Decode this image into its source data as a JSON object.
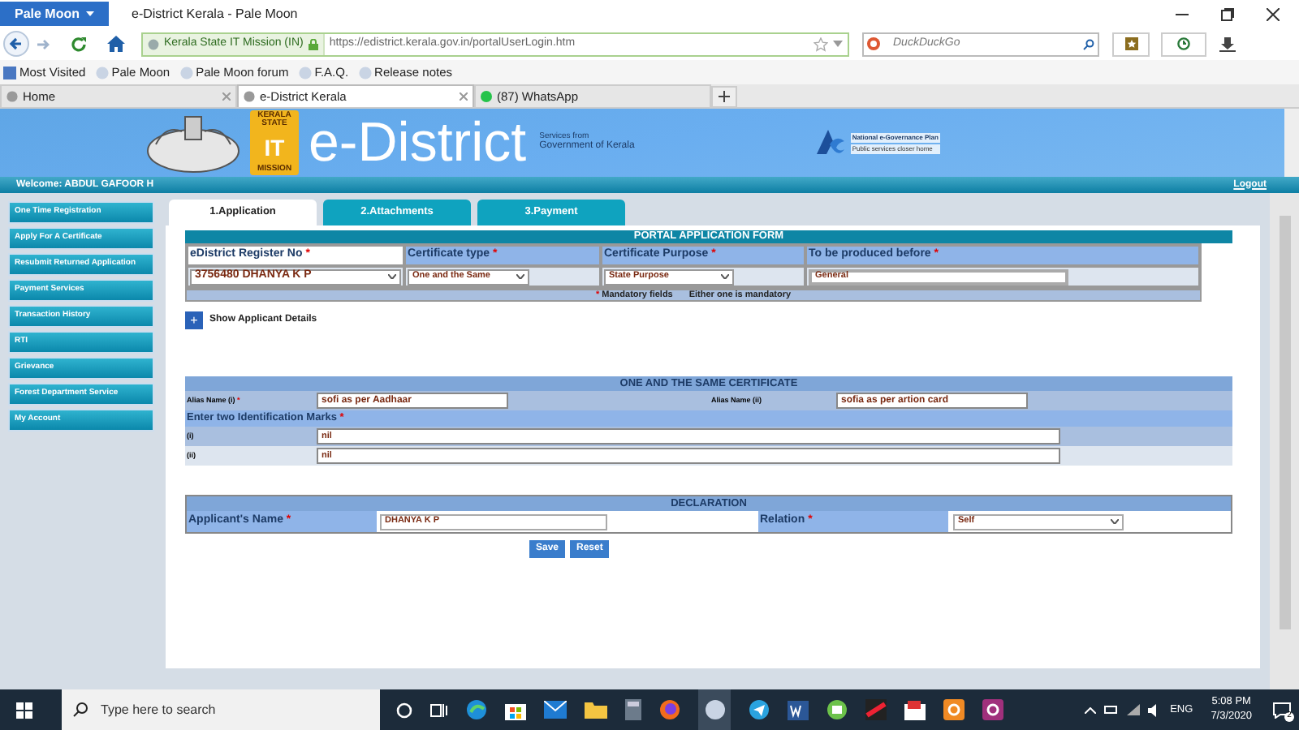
{
  "browser": {
    "menu_button": "Pale Moon",
    "title": "e-District Kerala - Pale Moon",
    "identity": "Kerala State IT Mission (IN)",
    "url": "https://edistrict.kerala.gov.in/portalUserLogin.htm",
    "search_placeholder": "DuckDuckGo"
  },
  "bookmarks": [
    "Most Visited",
    "Pale Moon",
    "Pale Moon forum",
    "F.A.Q.",
    "Release notes"
  ],
  "tabs": [
    {
      "label": "Home",
      "selected": false
    },
    {
      "label": "e-District Kerala",
      "selected": true
    },
    {
      "label": "(87) WhatsApp",
      "selected": false
    }
  ],
  "banner": {
    "badge_top": "KERALA STATE",
    "badge": "IT",
    "badge_bottom": "MISSION",
    "title": "e-District",
    "subtitle_1": "Services from",
    "subtitle_2": "Government of Kerala",
    "negp": "National e-Governance Plan",
    "negp_tagline": "Public services closer home"
  },
  "welcome": "Welcome: ABDUL GAFOOR H",
  "logout": "Logout",
  "sidebar": {
    "items": [
      "One Time Registration",
      "Apply For A Certificate",
      "Resubmit Returned Application",
      "Payment Services",
      "Transaction History",
      "RTI",
      "Grievance",
      "Forest Department Service",
      "My Account"
    ]
  },
  "form_tabs": [
    {
      "label": "1.Application",
      "selected": true
    },
    {
      "label": "2.Attachments",
      "selected": false
    },
    {
      "label": "3.Payment",
      "selected": false
    }
  ],
  "portal_form": {
    "title": "PORTAL APPLICATION FORM",
    "fields": [
      {
        "label": "eDistrict Register No",
        "mark": "*",
        "kind": "select",
        "value": "3756480 DHANYA K P"
      },
      {
        "label": "Certificate type",
        "mark": "*",
        "kind": "select",
        "value": "One and the Same"
      },
      {
        "label": "Certificate Purpose",
        "mark": "*",
        "kind": "select",
        "value": "State Purpose"
      },
      {
        "label": "To be produced before",
        "mark": "*",
        "kind": "input",
        "value": "General"
      }
    ],
    "note_mark": "*",
    "note": "Mandatory fields",
    "note_2": "Either one is mandatory"
  },
  "show_details": {
    "icon": "+",
    "label": "Show Applicant Details"
  },
  "same_certificate": {
    "title": "ONE AND THE SAME CERTIFICATE",
    "alias_1_label": "Alias Name (i)",
    "alias_1_mark": "*",
    "alias_1": "sofi as per Aadhaar",
    "alias_2_label": "Alias Name (ii)",
    "alias_2": "sofia as per artion card",
    "marks_heading": "Enter two Identification Marks",
    "marks_mark": "*",
    "marks": [
      {
        "label": "(i)",
        "value": "nil"
      },
      {
        "label": "(ii)",
        "value": "nil"
      }
    ]
  },
  "declaration": {
    "title": "DECLARATION",
    "name_label": "Applicant's Name",
    "name_mark": "*",
    "name": "DHANYA K P",
    "relation_label": "Relation",
    "relation_mark": "*",
    "relation": "Self"
  },
  "buttons": [
    "Save",
    "Reset"
  ],
  "taskbar": {
    "search_placeholder": "Type here to search",
    "language": "ENG",
    "time": "5:08 PM",
    "date": "7/3/2020",
    "notifications": "2"
  }
}
